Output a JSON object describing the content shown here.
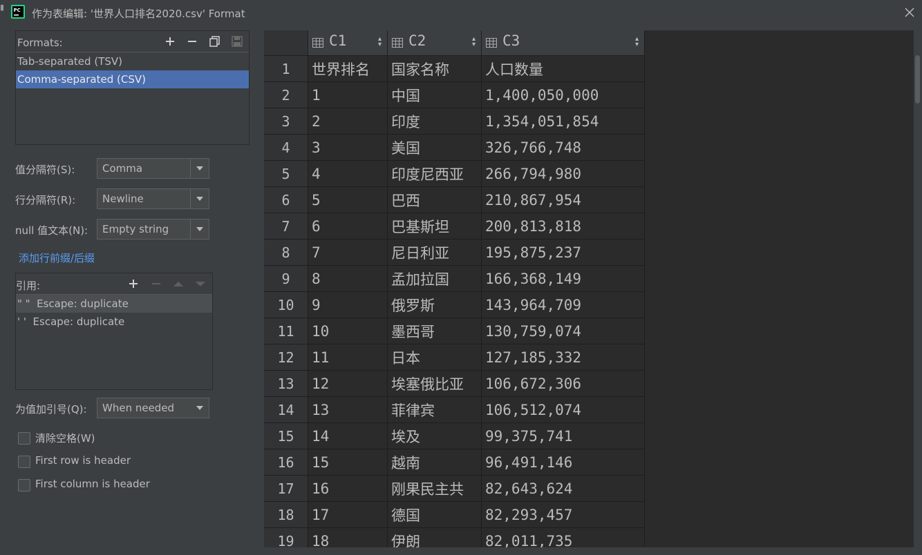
{
  "window": {
    "title": "作为表编辑: '世界人口排名2020.csv' Format",
    "app_icon": "pycharm-icon",
    "app_icon_text": "PC"
  },
  "formats": {
    "label": "Formats:",
    "items": [
      "Tab-separated (TSV)",
      "Comma-separated (CSV)"
    ],
    "selected": "Comma-separated (CSV)"
  },
  "settings": {
    "value_separator": {
      "label": "值分隔符(S):",
      "value": "Comma"
    },
    "row_separator": {
      "label": "行分隔符(R):",
      "value": "Newline"
    },
    "null_text": {
      "label": "null 值文本(N):",
      "value": "Empty string"
    },
    "add_prefix_link": "添加行前缀/后缀",
    "quote_values": {
      "label": "为值加引号(Q):",
      "value": "When needed"
    }
  },
  "quotes": {
    "label": "引用:",
    "items": [
      "\" \"  Escape: duplicate",
      "' '  Escape: duplicate"
    ]
  },
  "checkboxes": {
    "trim_spaces": "清除空格(W)",
    "first_row_header": "First row is header",
    "first_col_header": "First column is header"
  },
  "table": {
    "columns": [
      "C1",
      "C2",
      "C3"
    ],
    "rows": [
      [
        "1",
        "世界排名",
        "国家名称",
        "人口数量"
      ],
      [
        "2",
        "1",
        "中国",
        "1,400,050,000"
      ],
      [
        "3",
        "2",
        "印度",
        "1,354,051,854"
      ],
      [
        "4",
        "3",
        "美国",
        "326,766,748"
      ],
      [
        "5",
        "4",
        "印度尼西亚",
        "266,794,980"
      ],
      [
        "6",
        "5",
        "巴西",
        "210,867,954"
      ],
      [
        "7",
        "6",
        "巴基斯坦",
        "200,813,818"
      ],
      [
        "8",
        "7",
        "尼日利亚",
        "195,875,237"
      ],
      [
        "9",
        "8",
        "孟加拉国",
        "166,368,149"
      ],
      [
        "10",
        "9",
        "俄罗斯",
        "143,964,709"
      ],
      [
        "11",
        "10",
        "墨西哥",
        "130,759,074"
      ],
      [
        "12",
        "11",
        "日本",
        "127,185,332"
      ],
      [
        "13",
        "12",
        "埃塞俄比亚",
        "106,672,306"
      ],
      [
        "14",
        "13",
        "菲律宾",
        "106,512,074"
      ],
      [
        "15",
        "14",
        "埃及",
        "99,375,741"
      ],
      [
        "16",
        "15",
        "越南",
        "96,491,146"
      ],
      [
        "17",
        "16",
        "刚果民主共",
        "82,643,624"
      ],
      [
        "18",
        "17",
        "德国",
        "82,293,457"
      ],
      [
        "19",
        "18",
        "伊朗",
        "82,011,735"
      ]
    ]
  },
  "colors": {
    "selection": "#4b6eaf",
    "link": "#589df6",
    "background": "#3c3f41",
    "table_bg": "#2b2b2b"
  }
}
